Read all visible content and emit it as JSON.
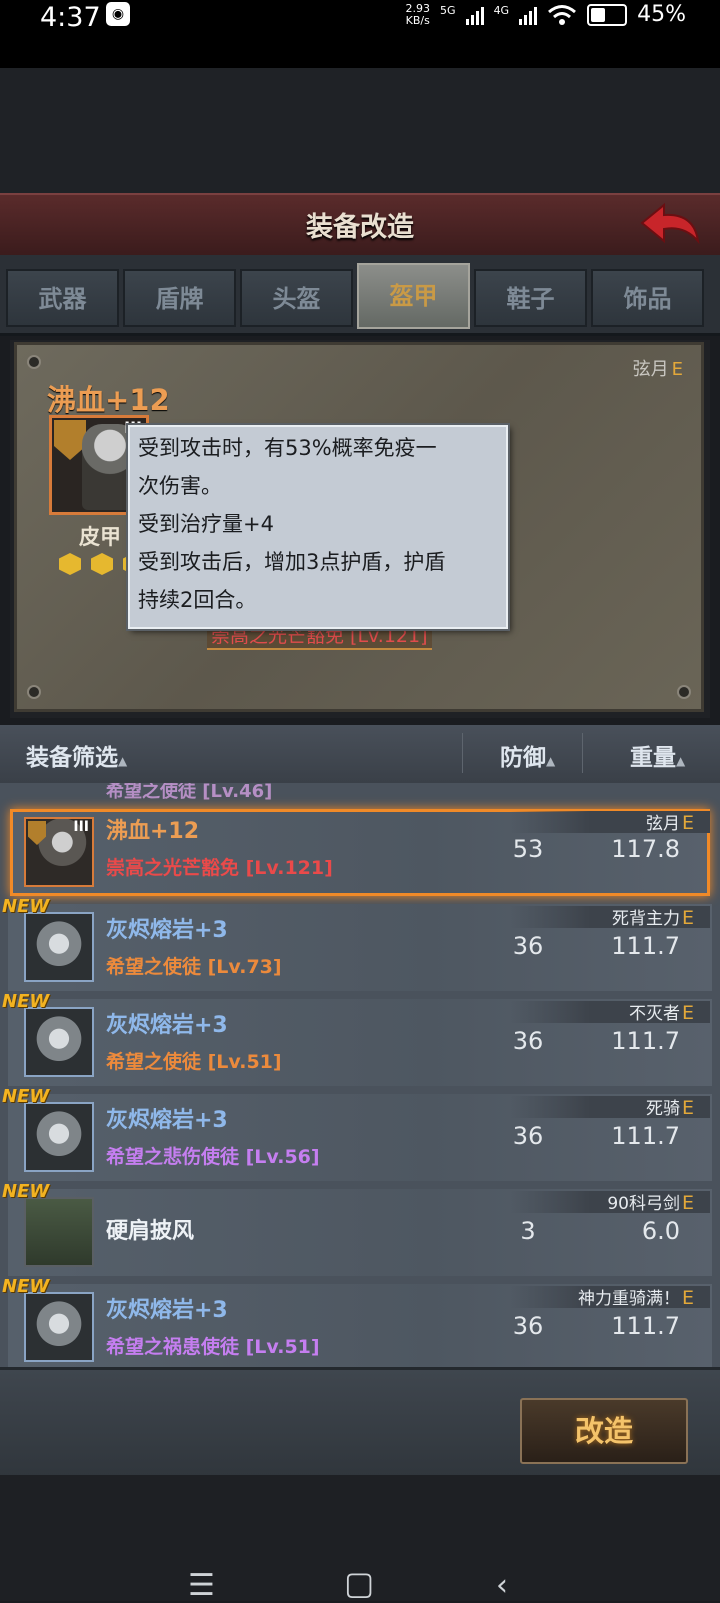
{
  "status": {
    "time": "4:37",
    "speed_value": "2.93",
    "speed_unit": "KB/s",
    "net1": "5G",
    "net2": "4G",
    "battery": "45%"
  },
  "header": {
    "title": "装备改造"
  },
  "tabs": [
    {
      "label": "武器",
      "active": false
    },
    {
      "label": "盾牌",
      "active": false
    },
    {
      "label": "头盔",
      "active": false
    },
    {
      "label": "盔甲",
      "active": true
    },
    {
      "label": "鞋子",
      "active": false
    },
    {
      "label": "饰品",
      "active": false
    }
  ],
  "detail": {
    "rank": "弦月",
    "rank_grade": "E",
    "name": "沸血+12",
    "tier": "III",
    "type": "皮甲",
    "star_count": 3,
    "series": "崇高之光芒豁免 [Lv.121]"
  },
  "tooltip": {
    "line1": "受到攻击时，有53%概率免疫一",
    "line2": "次伤害。",
    "line3": "受到治疗量+4",
    "line4": "受到攻击后，增加3点护盾，护盾",
    "line5": "持续2回合。"
  },
  "filter": {
    "label": "装备筛选",
    "defense": "防御",
    "weight": "重量",
    "sort_icon": "triangle-up-icon"
  },
  "list": {
    "clipped_top": "希望之使徒 [Lv.46]",
    "rows": [
      {
        "new": "",
        "name": "沸血+12",
        "tier": "III",
        "series": "崇高之光芒豁免 [Lv.121]",
        "defense": "53",
        "weight": "117.8",
        "tag": "弦月",
        "grade": "E"
      },
      {
        "new": "NEW",
        "name": "灰烬熔岩+3",
        "series": "希望之使徒 [Lv.73]",
        "defense": "36",
        "weight": "111.7",
        "tag": "死背主力",
        "grade": "E"
      },
      {
        "new": "NEW",
        "name": "灰烬熔岩+3",
        "series": "希望之使徒 [Lv.51]",
        "defense": "36",
        "weight": "111.7",
        "tag": "不灭者",
        "grade": "E"
      },
      {
        "new": "NEW",
        "name": "灰烬熔岩+3",
        "series": "希望之悲伤使徒 [Lv.56]",
        "defense": "36",
        "weight": "111.7",
        "tag": "死骑",
        "grade": "E"
      },
      {
        "new": "NEW",
        "name": "硬肩披风",
        "series": "",
        "defense": "3",
        "weight": "6.0",
        "tag": "90科弓剑",
        "grade": "E"
      },
      {
        "new": "NEW",
        "name": "灰烬熔岩+3",
        "series": "希望之祸患使徒 [Lv.51]",
        "defense": "36",
        "weight": "111.7",
        "tag": "神力重骑满！",
        "grade": "E"
      }
    ]
  },
  "actions": {
    "convert": "改造"
  },
  "colors": {
    "accent_orange": "#f08a28",
    "grade_yellow": "#e3a83a",
    "header_red": "#5a2b2b"
  }
}
